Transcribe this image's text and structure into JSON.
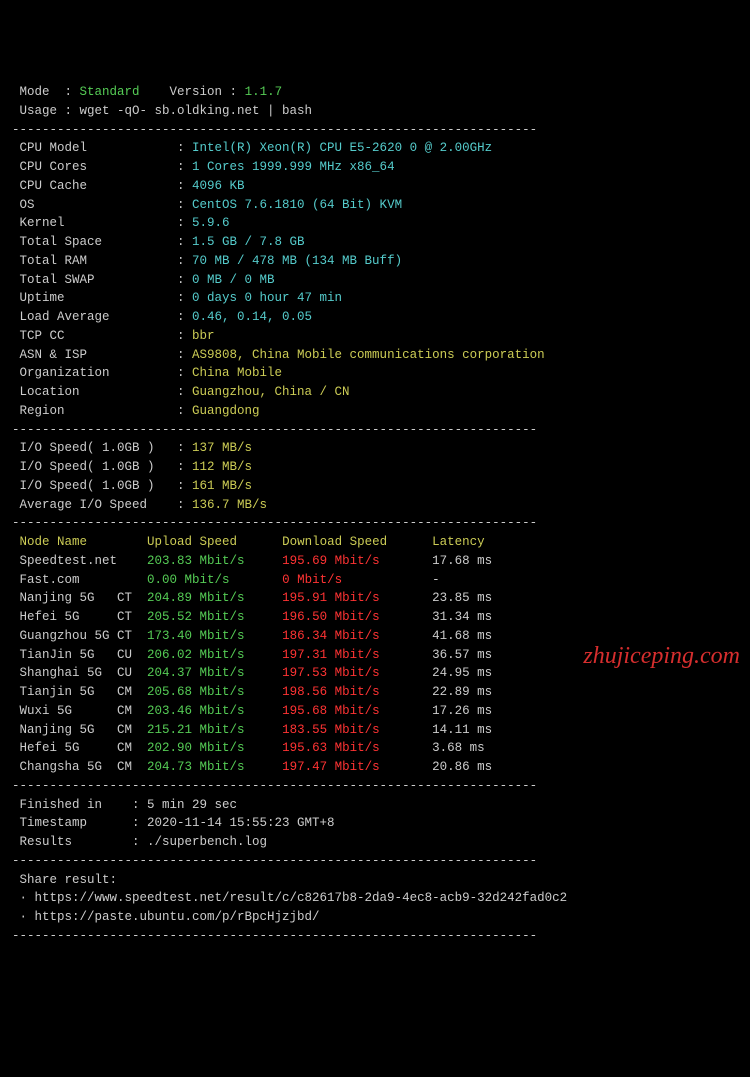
{
  "header": {
    "mode_label": " Mode  : ",
    "mode_value": "Standard",
    "version_label": "    Version : ",
    "version_value": "1.1.7",
    "usage_label": " Usage : ",
    "usage_value": "wget -qO- sb.oldking.net | bash"
  },
  "divider": "----------------------------------------------------------------------",
  "sysinfo": [
    {
      "label": " CPU Model            : ",
      "value": "Intel(R) Xeon(R) CPU E5-2620 0 @ 2.00GHz",
      "color": "cyan"
    },
    {
      "label": " CPU Cores            : ",
      "value": "1 Cores 1999.999 MHz x86_64",
      "color": "cyan"
    },
    {
      "label": " CPU Cache            : ",
      "value": "4096 KB",
      "color": "cyan"
    },
    {
      "label": " OS                   : ",
      "value": "CentOS 7.6.1810 (64 Bit) KVM",
      "color": "cyan"
    },
    {
      "label": " Kernel               : ",
      "value": "5.9.6",
      "color": "cyan"
    },
    {
      "label": " Total Space          : ",
      "value": "1.5 GB / 7.8 GB",
      "color": "cyan"
    },
    {
      "label": " Total RAM            : ",
      "value": "70 MB / 478 MB (134 MB Buff)",
      "color": "cyan"
    },
    {
      "label": " Total SWAP           : ",
      "value": "0 MB / 0 MB",
      "color": "cyan"
    },
    {
      "label": " Uptime               : ",
      "value": "0 days 0 hour 47 min",
      "color": "cyan"
    },
    {
      "label": " Load Average         : ",
      "value": "0.46, 0.14, 0.05",
      "color": "cyan"
    },
    {
      "label": " TCP CC               : ",
      "value": "bbr",
      "color": "yellow"
    },
    {
      "label": " ASN & ISP            : ",
      "value": "AS9808, China Mobile communications corporation",
      "color": "yellow"
    },
    {
      "label": " Organization         : ",
      "value": "China Mobile",
      "color": "yellow"
    },
    {
      "label": " Location             : ",
      "value": "Guangzhou, China / CN",
      "color": "yellow"
    },
    {
      "label": " Region               : ",
      "value": "Guangdong",
      "color": "yellow"
    }
  ],
  "iospeed": [
    {
      "label": " I/O Speed( 1.0GB )   : ",
      "value": "137 MB/s"
    },
    {
      "label": " I/O Speed( 1.0GB )   : ",
      "value": "112 MB/s"
    },
    {
      "label": " I/O Speed( 1.0GB )   : ",
      "value": "161 MB/s"
    },
    {
      "label": " Average I/O Speed    : ",
      "value": "136.7 MB/s"
    }
  ],
  "speed_header": {
    "node": " Node Name        ",
    "upload": "Upload Speed      ",
    "download": "Download Speed      ",
    "latency": "Latency     "
  },
  "speedtests": [
    {
      "node": " Speedtest.net    ",
      "upload": "203.83 Mbit/s     ",
      "download": "195.69 Mbit/s       ",
      "latency": "17.68 ms"
    },
    {
      "node": " Fast.com         ",
      "upload": "0.00 Mbit/s       ",
      "download": "0 Mbit/s            ",
      "latency": "-"
    },
    {
      "node": " Nanjing 5G   CT  ",
      "upload": "204.89 Mbit/s     ",
      "download": "195.91 Mbit/s       ",
      "latency": "23.85 ms"
    },
    {
      "node": " Hefei 5G     CT  ",
      "upload": "205.52 Mbit/s     ",
      "download": "196.50 Mbit/s       ",
      "latency": "31.34 ms"
    },
    {
      "node": " Guangzhou 5G CT  ",
      "upload": "173.40 Mbit/s     ",
      "download": "186.34 Mbit/s       ",
      "latency": "41.68 ms"
    },
    {
      "node": " TianJin 5G   CU  ",
      "upload": "206.02 Mbit/s     ",
      "download": "197.31 Mbit/s       ",
      "latency": "36.57 ms"
    },
    {
      "node": " Shanghai 5G  CU  ",
      "upload": "204.37 Mbit/s     ",
      "download": "197.53 Mbit/s       ",
      "latency": "24.95 ms"
    },
    {
      "node": " Tianjin 5G   CM  ",
      "upload": "205.68 Mbit/s     ",
      "download": "198.56 Mbit/s       ",
      "latency": "22.89 ms"
    },
    {
      "node": " Wuxi 5G      CM  ",
      "upload": "203.46 Mbit/s     ",
      "download": "195.68 Mbit/s       ",
      "latency": "17.26 ms"
    },
    {
      "node": " Nanjing 5G   CM  ",
      "upload": "215.21 Mbit/s     ",
      "download": "183.55 Mbit/s       ",
      "latency": "14.11 ms"
    },
    {
      "node": " Hefei 5G     CM  ",
      "upload": "202.90 Mbit/s     ",
      "download": "195.63 Mbit/s       ",
      "latency": "3.68 ms"
    },
    {
      "node": " Changsha 5G  CM  ",
      "upload": "204.73 Mbit/s     ",
      "download": "197.47 Mbit/s       ",
      "latency": "20.86 ms"
    }
  ],
  "footer": [
    {
      "label": " Finished in    : ",
      "value": "5 min 29 sec"
    },
    {
      "label": " Timestamp      : ",
      "value": "2020-11-14 15:55:23 GMT+8"
    },
    {
      "label": " Results        : ",
      "value": "./superbench.log"
    }
  ],
  "share": {
    "label": " Share result:",
    "links": [
      " · https://www.speedtest.net/result/c/c82617b8-2da9-4ec8-acb9-32d242fad0c2",
      " · https://paste.ubuntu.com/p/rBpcHjzjbd/"
    ]
  },
  "watermark": "zhujiceping.com"
}
